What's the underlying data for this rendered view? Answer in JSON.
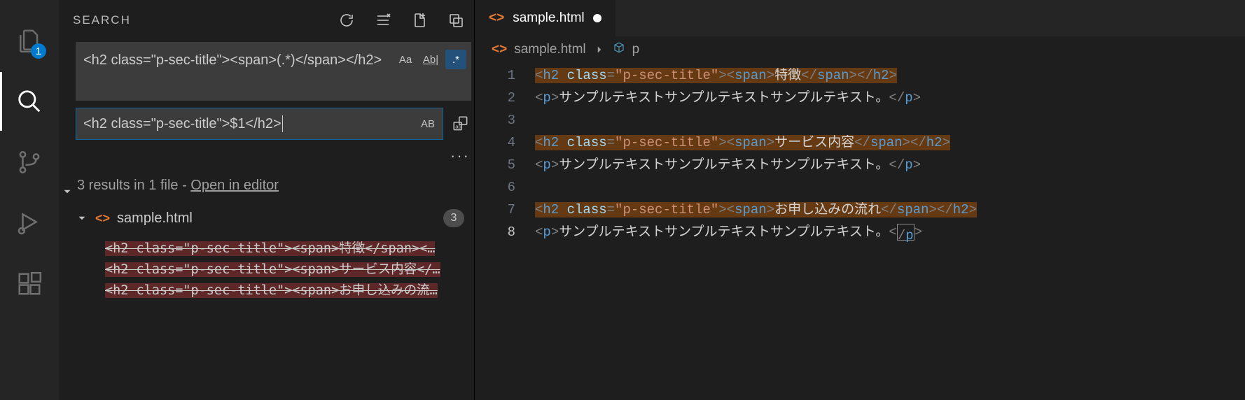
{
  "activity": {
    "explorer_badge": "1"
  },
  "search": {
    "title": "SEARCH",
    "find_value": "<h2 class=\"p-sec-title\"><span>(.*)</span></h2>",
    "replace_value": "<h2 class=\"p-sec-title\">$1</h2>",
    "opts": {
      "case": "Aa",
      "word": "Ab|",
      "regex": ".*",
      "preserve": "AB"
    },
    "summary_prefix": "3 results in 1 file - ",
    "summary_link": "Open in editor",
    "ellipsis": "···"
  },
  "results": {
    "file": "sample.html",
    "count": "3",
    "matches": [
      "<h2 class=\"p-sec-title\"><span>特徴</span><…",
      "<h2 class=\"p-sec-title\"><span>サービス内容</…",
      "<h2 class=\"p-sec-title\"><span>お申し込みの流…"
    ]
  },
  "editor": {
    "tab_name": "sample.html",
    "breadcrumb_file": "sample.html",
    "breadcrumb_symbol": "p",
    "lines": [
      {
        "n": "1",
        "highlight": true,
        "h2": true,
        "text": "特徴"
      },
      {
        "n": "2",
        "highlight": false,
        "h2": false,
        "text": "サンプルテキストサンプルテキストサンプルテキスト。"
      },
      {
        "n": "3",
        "highlight": false,
        "blank": true
      },
      {
        "n": "4",
        "highlight": true,
        "h2": true,
        "text": "サービス内容"
      },
      {
        "n": "5",
        "highlight": false,
        "h2": false,
        "text": "サンプルテキストサンプルテキストサンプルテキスト。"
      },
      {
        "n": "6",
        "highlight": false,
        "blank": true
      },
      {
        "n": "7",
        "highlight": true,
        "h2": true,
        "text": "お申し込みの流れ"
      },
      {
        "n": "8",
        "highlight": false,
        "h2": false,
        "text": "サンプルテキストサンプルテキストサンプルテキスト。",
        "current": true
      }
    ]
  }
}
